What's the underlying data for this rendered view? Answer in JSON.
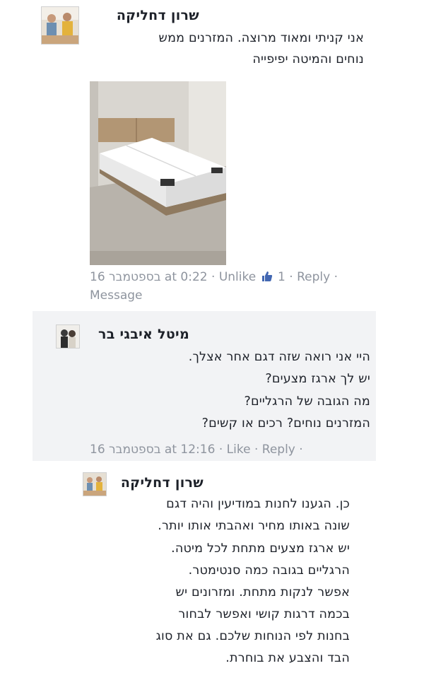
{
  "comment1": {
    "author": "שרון דחליקה",
    "lines": [
      "אני קניתי ומאוד מרוצה. המזרנים ממש",
      "נוחים והמיטה יפיפייה"
    ],
    "meta_time": "16 בספטמבר at 0:22",
    "meta_unlike": "Unlike",
    "meta_likes": "1",
    "meta_reply": "Reply",
    "meta_message": "Message",
    "sep": "·"
  },
  "comment2": {
    "author": "מיטל איבגי בר",
    "lines": [
      "היי אני רואה שזה דגם אחר אצלך.",
      "יש לך ארגז מצעים?",
      "מה הגובה של הרגליים?",
      "המזרנים נוחים? רכים או קשים?"
    ],
    "meta_time": "16 בספטמבר at 12:16",
    "meta_like": "Like",
    "meta_reply": "Reply",
    "sep": "·"
  },
  "comment3": {
    "author": "שרון דחליקה",
    "lines": [
      "כן. הגענו לחנות במודיעין והיה דגם",
      "שונה באותו מחיר ואהבתי אותו יותר.",
      "יש ארגז מצעים מתחת לכל מיטה.",
      "הרגליים בגובה כמה סנטימטר.",
      "אפשר לנקות מתחת. ומזרונים יש",
      "בכמה דרגות קושי ואפשר לבחור",
      "בחנות לפי הנוחות שלכם. גם את סוג",
      "הבד והצבע את בוחרת."
    ]
  },
  "colors": {
    "name": "#1d2129",
    "meta": "#8e949e",
    "like_blue": "#4267b2",
    "band": "#f2f3f5"
  }
}
